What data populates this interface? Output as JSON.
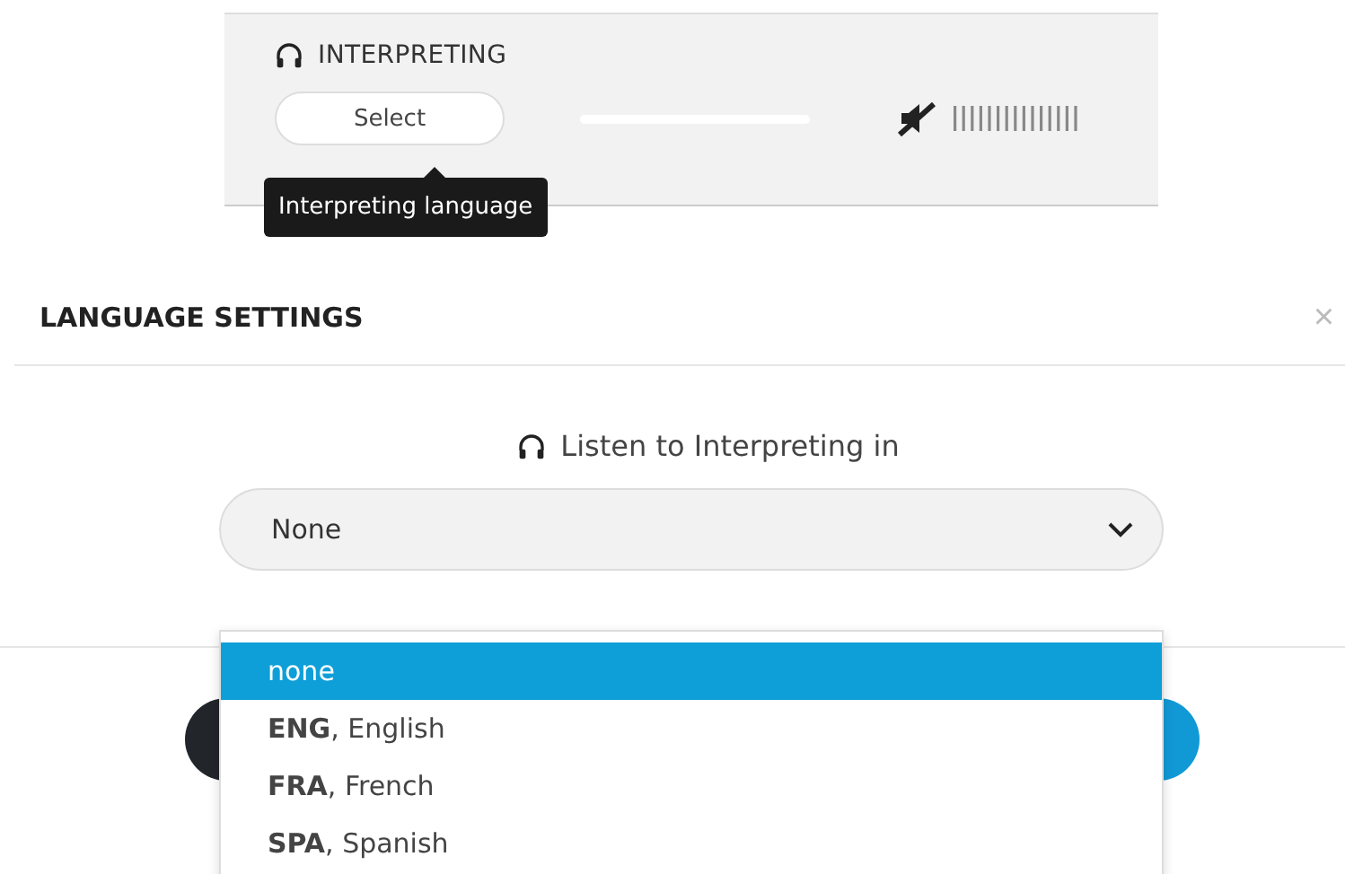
{
  "interpreting_panel": {
    "title": "INTERPRETING",
    "select_button": "Select",
    "tooltip": "Interpreting language",
    "muted": true
  },
  "dialog": {
    "title": "LANGUAGE SETTINGS",
    "close": "×",
    "prompt": "Listen to Interpreting in",
    "select": {
      "value": "None",
      "expanded": true
    },
    "options": [
      {
        "label": "none",
        "selected": true
      },
      {
        "label": "**ENG**, English",
        "selected": false
      },
      {
        "label": "**FRA**, French",
        "selected": false
      },
      {
        "label": "**SPA**, Spanish",
        "selected": false
      }
    ]
  }
}
